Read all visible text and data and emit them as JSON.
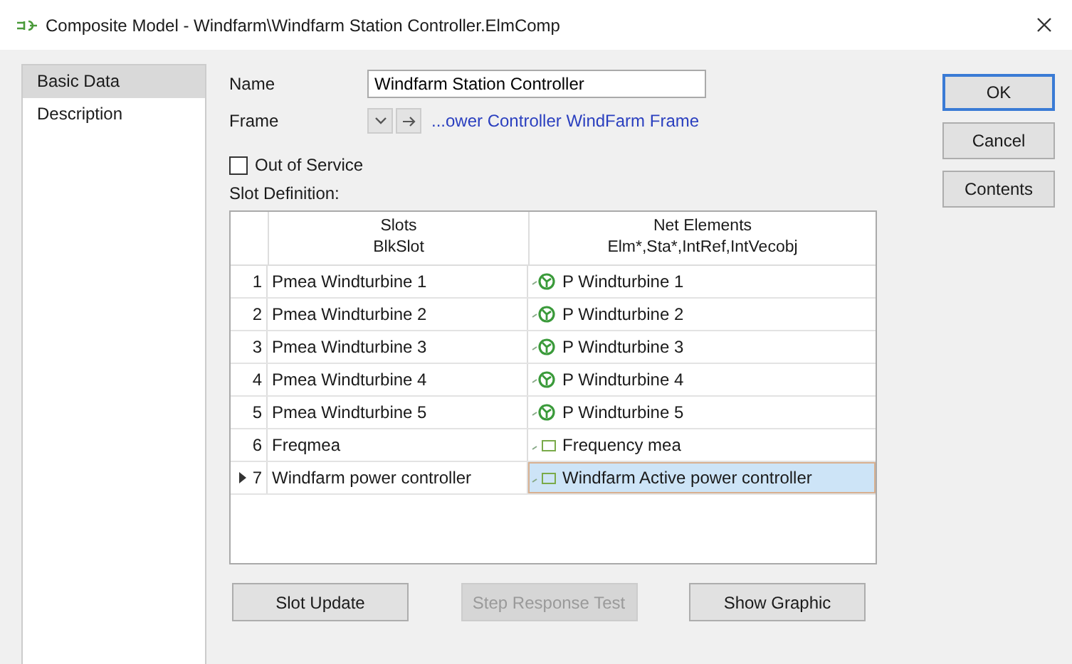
{
  "window": {
    "title": "Composite Model - Windfarm\\Windfarm Station Controller.ElmComp"
  },
  "sidebar": {
    "items": [
      {
        "label": "Basic Data",
        "selected": true
      },
      {
        "label": "Description",
        "selected": false
      }
    ]
  },
  "name": {
    "label": "Name",
    "value": "Windfarm Station Controller"
  },
  "frame": {
    "label": "Frame",
    "link": "...ower Controller WindFarm Frame"
  },
  "out_of_service": {
    "label": "Out of Service",
    "checked": false
  },
  "slot_definition": {
    "label": "Slot Definition:",
    "columns": [
      {
        "title": "Slots",
        "subtitle": "BlkSlot"
      },
      {
        "title": "Net Elements",
        "subtitle": "Elm*,Sta*,IntRef,IntVecobj"
      }
    ],
    "rows": [
      {
        "index": "1",
        "slot": "Pmea Windturbine 1",
        "element": "P Windturbine 1",
        "kind": "turbine",
        "selected": false
      },
      {
        "index": "2",
        "slot": "Pmea Windturbine 2",
        "element": "P Windturbine 2",
        "kind": "turbine",
        "selected": false
      },
      {
        "index": "3",
        "slot": "Pmea Windturbine 3",
        "element": "P Windturbine 3",
        "kind": "turbine",
        "selected": false
      },
      {
        "index": "4",
        "slot": "Pmea Windturbine 4",
        "element": "P Windturbine 4",
        "kind": "turbine",
        "selected": false
      },
      {
        "index": "5",
        "slot": "Pmea Windturbine 5",
        "element": "P Windturbine 5",
        "kind": "turbine",
        "selected": false
      },
      {
        "index": "6",
        "slot": "Freqmea",
        "element": "Frequency mea",
        "kind": "model",
        "selected": false
      },
      {
        "index": "7",
        "slot": "Windfarm power controller",
        "element": "Windfarm Active power controller",
        "kind": "model",
        "selected": true
      }
    ]
  },
  "bottom_buttons": [
    {
      "label": "Slot Update",
      "disabled": false
    },
    {
      "label": "Step Response Test",
      "disabled": true
    },
    {
      "label": "Show Graphic",
      "disabled": false
    }
  ],
  "side_buttons": [
    {
      "label": "OK",
      "default": true
    },
    {
      "label": "Cancel",
      "default": false
    },
    {
      "label": "Contents",
      "default": false
    }
  ]
}
